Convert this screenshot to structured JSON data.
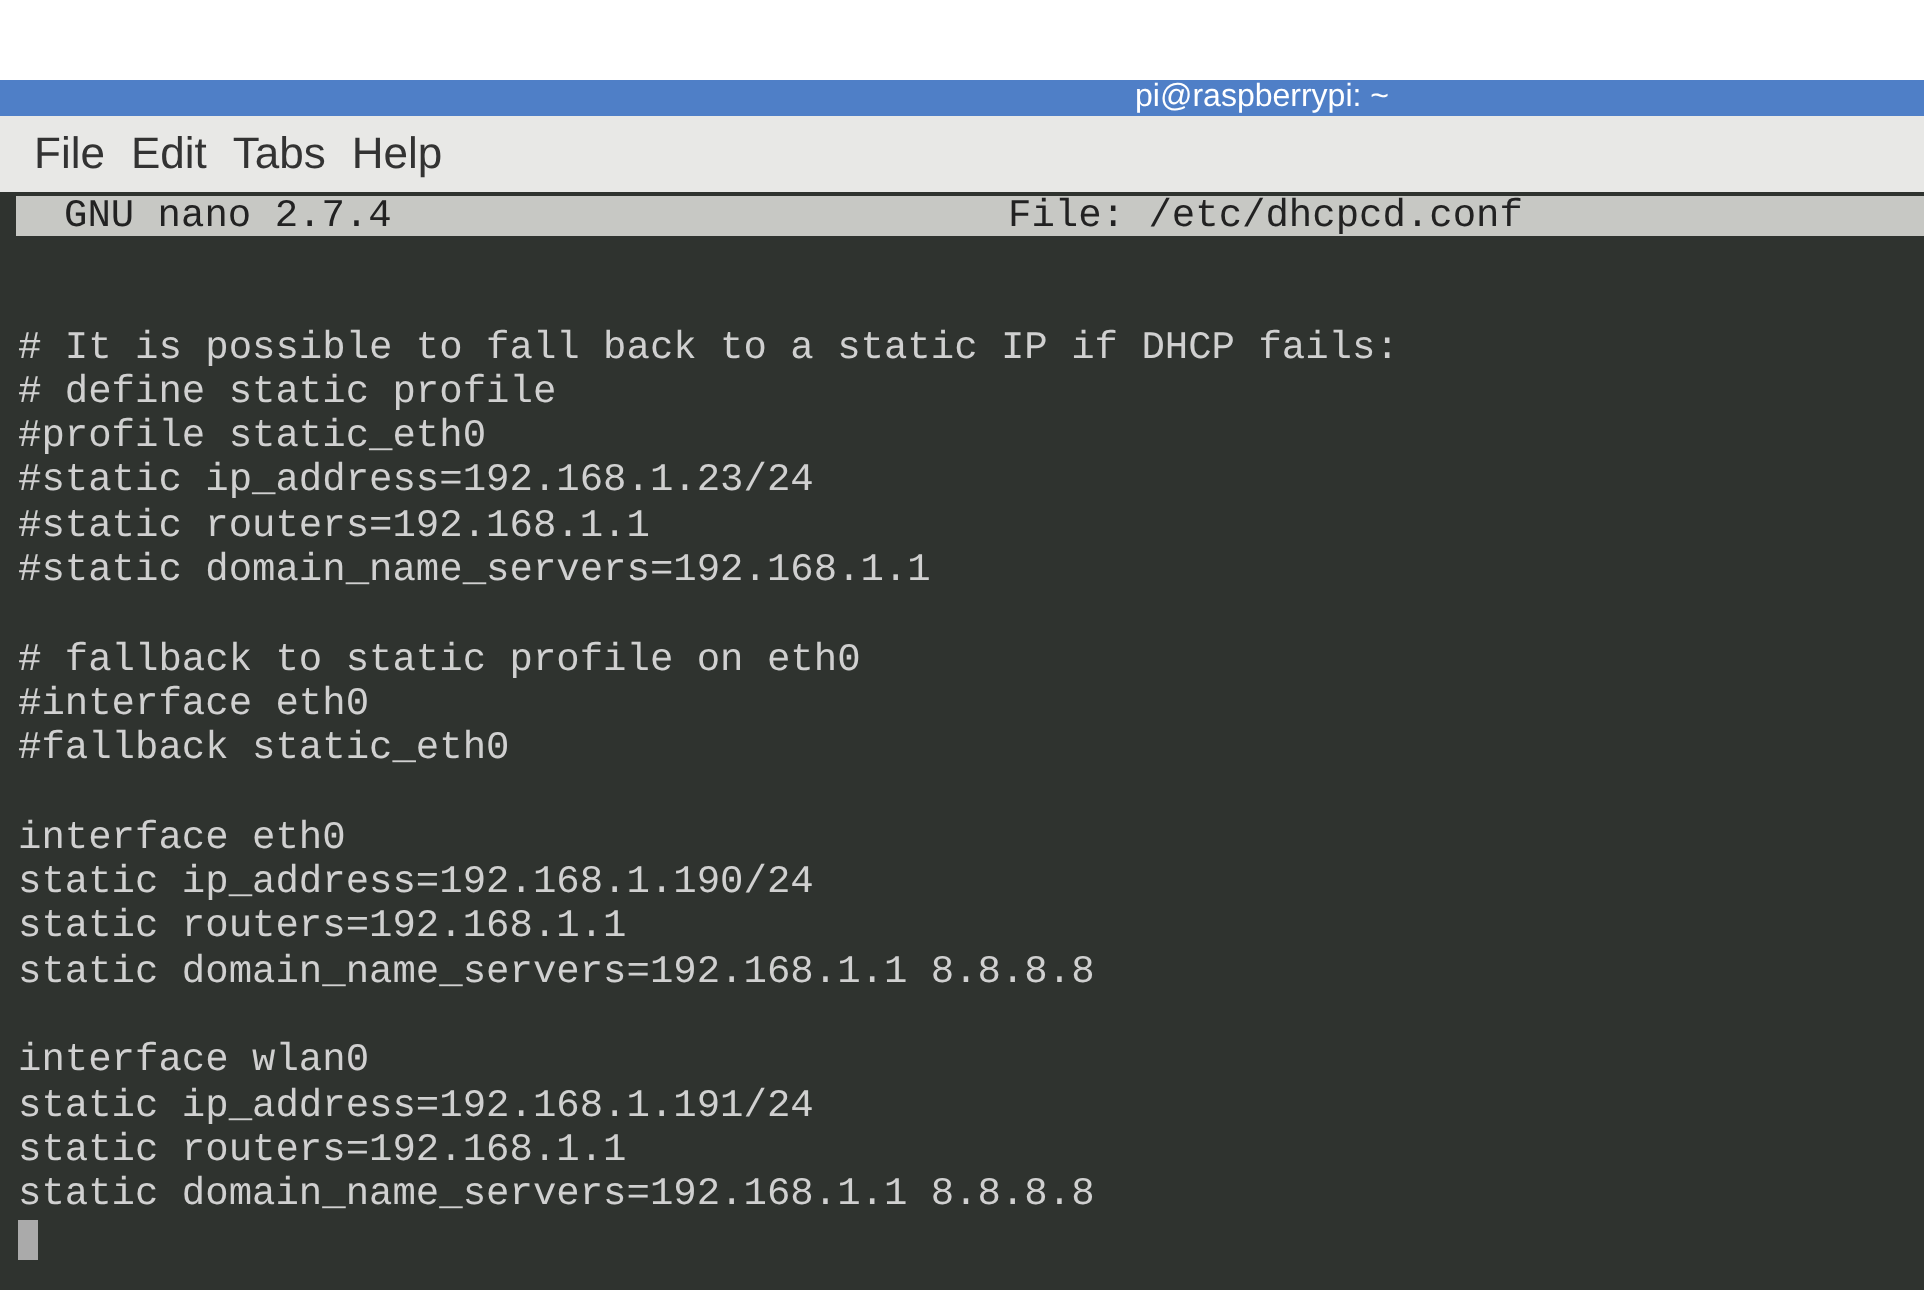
{
  "window": {
    "title": "pi@raspberrypi: ~"
  },
  "menu_bar": [
    "File",
    "Edit",
    "Tabs",
    "Help"
  ],
  "nano_header": {
    "version": "GNU nano 2.7.4",
    "file": "File: /etc/dhcpcd.conf"
  },
  "editor": {
    "blocks": [
      [
        "# It is possible to fall back to a static IP if DHCP fails:",
        "# define static profile",
        "#profile static_eth0",
        "#static ip_address=192.168.1.23/24",
        "#static routers=192.168.1.1",
        "#static domain_name_servers=192.168.1.1"
      ],
      [
        "# fallback to static profile on eth0",
        "#interface eth0",
        "#fallback static_eth0"
      ],
      [
        "interface eth0",
        "static ip_address=192.168.1.190/24",
        "static routers=192.168.1.1",
        "static domain_name_servers=192.168.1.1 8.8.8.8"
      ],
      [
        "interface wlan0",
        "static ip_address=192.168.1.191/24",
        "static routers=192.168.1.1",
        "static domain_name_servers=192.168.1.1 8.8.8.8"
      ]
    ],
    "cursor": true
  }
}
